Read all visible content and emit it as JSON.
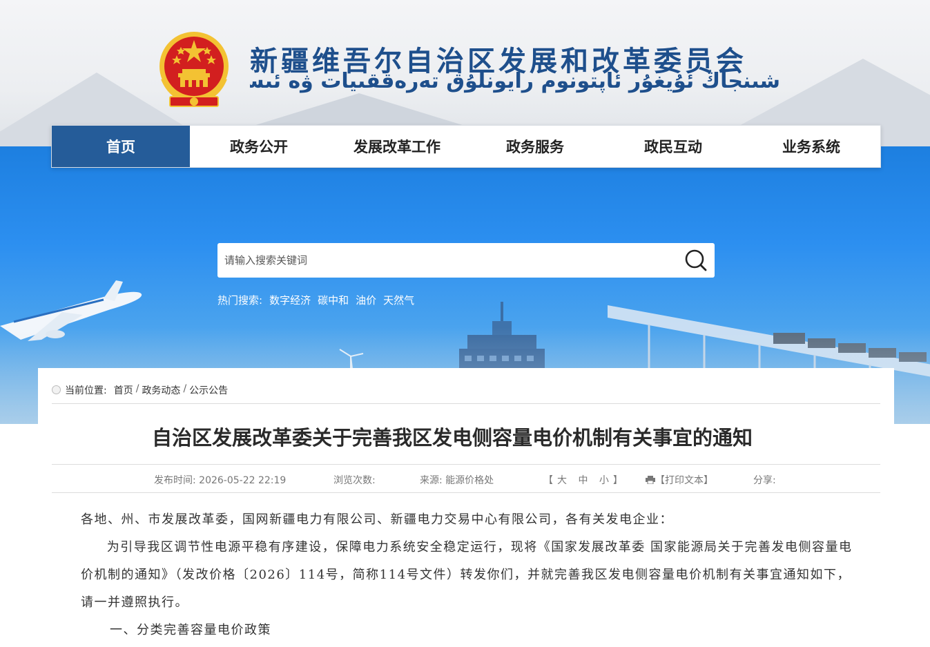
{
  "header": {
    "title_cn": "新疆维吾尔自治区发展和改革委员会",
    "title_ug": "شىنجاڭ ئۇيغۇر ئاپتونوم رايونلۇق تەرەققىيات ۋە ئىسلاھات كومىتېتى"
  },
  "nav": {
    "items": [
      {
        "label": "首页"
      },
      {
        "label": "政务公开"
      },
      {
        "label": "发展改革工作"
      },
      {
        "label": "政务服务"
      },
      {
        "label": "政民互动"
      },
      {
        "label": "业务系统"
      }
    ]
  },
  "search": {
    "placeholder": "请输入搜索关键词",
    "hot_label": "热门搜索:",
    "hot_terms": [
      "数字经济",
      "碳中和",
      "油价",
      "天然气"
    ]
  },
  "breadcrumb": {
    "label": "当前位置:",
    "items": [
      "首页",
      "政务动态",
      "公示公告"
    ],
    "separator": "/"
  },
  "article": {
    "title": "自治区发展改革委关于完善我区发电侧容量电价机制有关事宜的通知",
    "meta": {
      "publish_time": "发布时间:  2026-05-22 22:19",
      "views": "浏览次数:",
      "source": "来源:  能源价格处",
      "font_size": "【大 中 小】",
      "print": "【打印文本】",
      "share": "分享:"
    },
    "paragraphs": [
      "各地、州、市发展改革委，国网新疆电力有限公司、新疆电力交易中心有限公司，各有关发电企业：",
      "为引导我区调节性电源平稳有序建设，保障电力系统安全稳定运行，现将《国家发展改革委 国家能源局关于完善发电侧容量电价机制的通知》（发改价格〔2026〕114号，简称114号文件）转发你们，并就完善我区发电侧容量电价机制有关事宜通知如下，请一并遵照执行。",
      "一、分类完善容量电价政策"
    ]
  },
  "colors": {
    "nav_active": "#255c99",
    "title_blue": "#1e4f8c",
    "emblem_red": "#d21f1f",
    "emblem_gold": "#f3c233"
  }
}
